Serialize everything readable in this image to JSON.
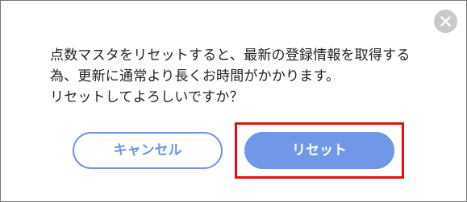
{
  "dialog": {
    "message_lines": [
      "点数マスタをリセットすると、最新の登録情報を取得する",
      "為、更新に通常より長くお時間がかかります。",
      "リセットしてよろしいですか？"
    ],
    "close_icon": "close-icon",
    "cancel_label": "キャンセル",
    "reset_label": "リセット"
  },
  "colors": {
    "accent": "#7097e8",
    "highlight": "#e01010",
    "close_bg": "#c9c9c9"
  }
}
